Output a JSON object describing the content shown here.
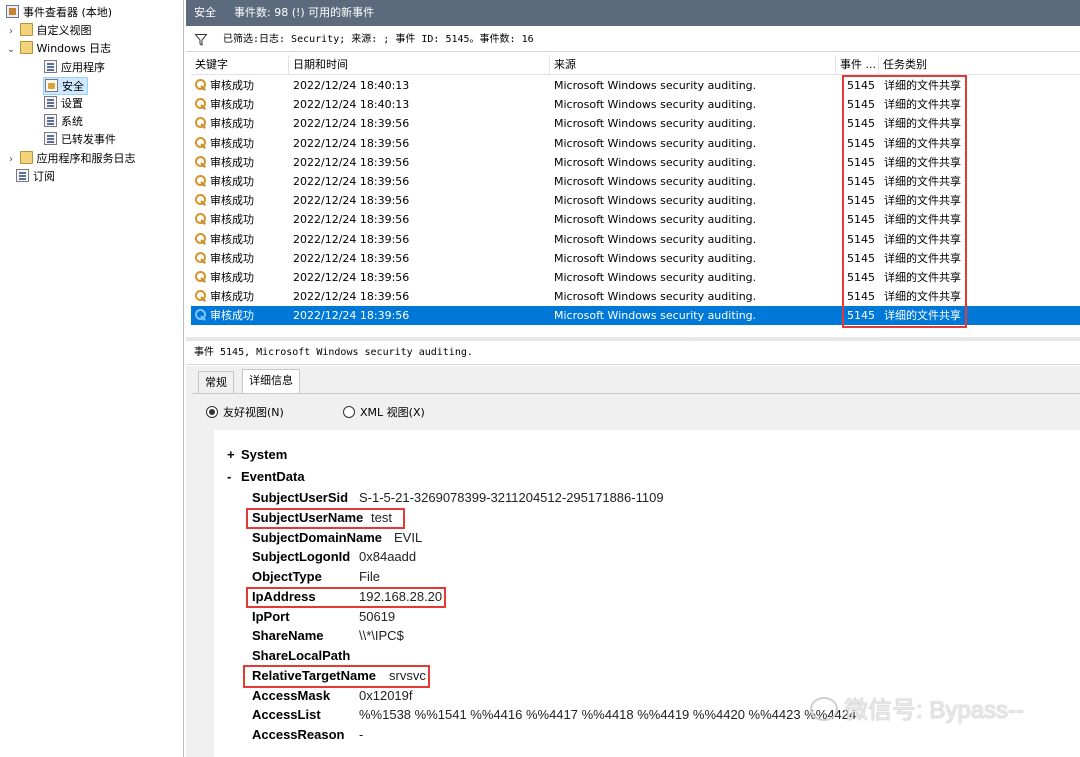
{
  "tree": {
    "root": "事件查看器 (本地)",
    "custom_views": "自定义视图",
    "windows_logs": "Windows 日志",
    "logs": [
      "应用程序",
      "安全",
      "设置",
      "系统",
      "已转发事件"
    ],
    "app_services": "应用程序和服务日志",
    "subscriptions": "订阅"
  },
  "topbar": {
    "title": "安全",
    "count_text": "事件数: 98 (!) 可用的新事件"
  },
  "filter": {
    "text": "已筛选:日志: Security; 来源: ; 事件 ID: 5145。事件数: 16"
  },
  "grid": {
    "columns": [
      "关键字",
      "日期和时间",
      "来源",
      "事件 ...",
      "任务类别"
    ],
    "rows": [
      {
        "keyword": "审核成功",
        "date": "2022/12/24 18:40:13",
        "source": "Microsoft Windows security auditing.",
        "id": "5145",
        "task": "详细的文件共享"
      },
      {
        "keyword": "审核成功",
        "date": "2022/12/24 18:40:13",
        "source": "Microsoft Windows security auditing.",
        "id": "5145",
        "task": "详细的文件共享"
      },
      {
        "keyword": "审核成功",
        "date": "2022/12/24 18:39:56",
        "source": "Microsoft Windows security auditing.",
        "id": "5145",
        "task": "详细的文件共享"
      },
      {
        "keyword": "审核成功",
        "date": "2022/12/24 18:39:56",
        "source": "Microsoft Windows security auditing.",
        "id": "5145",
        "task": "详细的文件共享"
      },
      {
        "keyword": "审核成功",
        "date": "2022/12/24 18:39:56",
        "source": "Microsoft Windows security auditing.",
        "id": "5145",
        "task": "详细的文件共享"
      },
      {
        "keyword": "审核成功",
        "date": "2022/12/24 18:39:56",
        "source": "Microsoft Windows security auditing.",
        "id": "5145",
        "task": "详细的文件共享"
      },
      {
        "keyword": "审核成功",
        "date": "2022/12/24 18:39:56",
        "source": "Microsoft Windows security auditing.",
        "id": "5145",
        "task": "详细的文件共享"
      },
      {
        "keyword": "审核成功",
        "date": "2022/12/24 18:39:56",
        "source": "Microsoft Windows security auditing.",
        "id": "5145",
        "task": "详细的文件共享"
      },
      {
        "keyword": "审核成功",
        "date": "2022/12/24 18:39:56",
        "source": "Microsoft Windows security auditing.",
        "id": "5145",
        "task": "详细的文件共享"
      },
      {
        "keyword": "审核成功",
        "date": "2022/12/24 18:39:56",
        "source": "Microsoft Windows security auditing.",
        "id": "5145",
        "task": "详细的文件共享"
      },
      {
        "keyword": "审核成功",
        "date": "2022/12/24 18:39:56",
        "source": "Microsoft Windows security auditing.",
        "id": "5145",
        "task": "详细的文件共享"
      },
      {
        "keyword": "审核成功",
        "date": "2022/12/24 18:39:56",
        "source": "Microsoft Windows security auditing.",
        "id": "5145",
        "task": "详细的文件共享"
      },
      {
        "keyword": "审核成功",
        "date": "2022/12/24 18:39:56",
        "source": "Microsoft Windows security auditing.",
        "id": "5145",
        "task": "详细的文件共享"
      }
    ],
    "selected_index": 12
  },
  "details": {
    "header": "事件 5145, Microsoft Windows security auditing.",
    "tabs": [
      "常规",
      "详细信息"
    ],
    "radio_friendly": "友好视图(N)",
    "radio_xml": "XML 视图(X)",
    "system_label": "System",
    "eventdata_label": "EventData",
    "fields": [
      {
        "name": "SubjectUserSid",
        "value": "S-1-5-21-3269078399-3211204512-295171886-1109"
      },
      {
        "name": "SubjectUserName",
        "value": "test"
      },
      {
        "name": "SubjectDomainName",
        "value": "EVIL"
      },
      {
        "name": "SubjectLogonId",
        "value": "0x84aadd"
      },
      {
        "name": "ObjectType",
        "value": "File"
      },
      {
        "name": "IpAddress",
        "value": "192.168.28.20"
      },
      {
        "name": "IpPort",
        "value": "50619"
      },
      {
        "name": "ShareName",
        "value": "\\\\*\\IPC$"
      },
      {
        "name": "ShareLocalPath",
        "value": ""
      },
      {
        "name": "RelativeTargetName",
        "value": "srvsvc"
      },
      {
        "name": "AccessMask",
        "value": "0x12019f"
      },
      {
        "name": "AccessList",
        "value": "%%1538 %%1541 %%4416 %%4417 %%4418 %%4419 %%4420 %%4423 %%4424"
      },
      {
        "name": "AccessReason",
        "value": "-"
      }
    ]
  },
  "watermark": "微信号: Bypass--",
  "colors": {
    "selection": "#0078d7",
    "highlight_box": "#e53935",
    "topbar": "#5b6a7d"
  }
}
